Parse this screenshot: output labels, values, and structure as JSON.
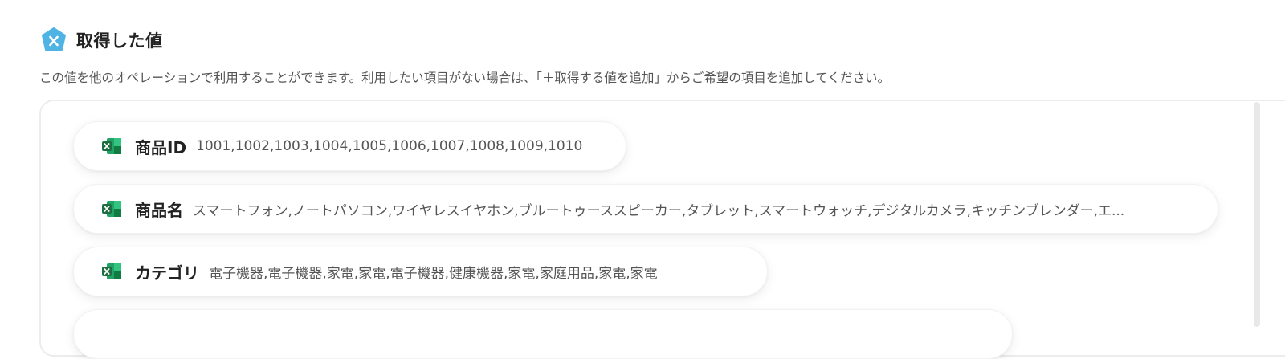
{
  "section": {
    "title": "取得した値",
    "description": "この値を他のオペレーションで利用することができます。利用したい項目がない場合は、「＋取得する値を追加」からご希望の項目を追加してください。",
    "icon": "app-hexagon-x-icon"
  },
  "colors": {
    "app_icon": "#4fb3e3",
    "excel_green_dark": "#1d6f42",
    "excel_green_light": "#33c481"
  },
  "values": [
    {
      "label": "商品ID",
      "value": "1001,1002,1003,1004,1005,1006,1007,1008,1009,1010",
      "icon": "excel-icon"
    },
    {
      "label": "商品名",
      "value": "スマートフォン,ノートパソコン,ワイヤレスイヤホン,ブルートゥーススピーカー,タブレット,スマートウォッチ,デジタルカメラ,キッチンブレンダー,エ...",
      "icon": "excel-icon"
    },
    {
      "label": "カテゴリ",
      "value": "電子機器,電子機器,家電,家電,電子機器,健康機器,家電,家庭用品,家電,家電",
      "icon": "excel-icon"
    }
  ]
}
